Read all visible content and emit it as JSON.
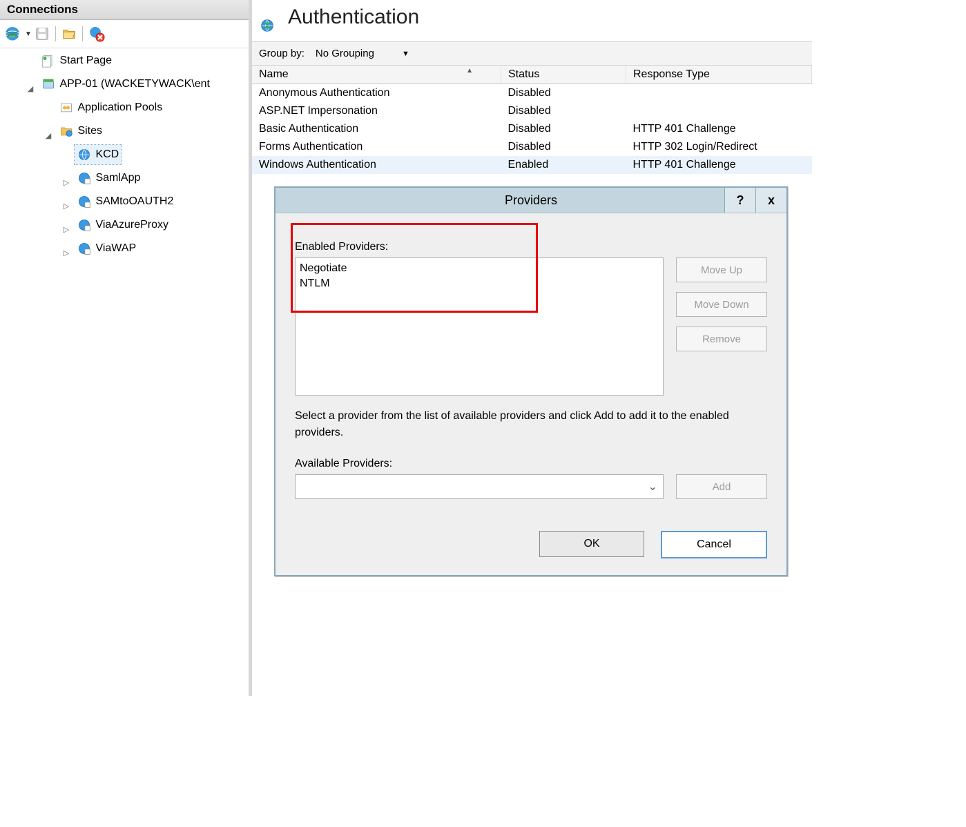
{
  "left": {
    "title": "Connections",
    "tree": {
      "start_page": "Start Page",
      "server": "APP-01 (WACKETYWACK\\ent",
      "app_pools": "Application Pools",
      "sites_label": "Sites",
      "sites": [
        "KCD",
        "SamlApp",
        "SAMtoOAUTH2",
        "ViaAzureProxy",
        "ViaWAP"
      ],
      "selected_site_index": 0
    }
  },
  "header": {
    "title": "Authentication"
  },
  "group_by": {
    "label": "Group by:",
    "value": "No Grouping"
  },
  "grid": {
    "columns": [
      "Name",
      "Status",
      "Response Type"
    ],
    "rows": [
      {
        "name": "Anonymous Authentication",
        "status": "Disabled",
        "response": ""
      },
      {
        "name": "ASP.NET Impersonation",
        "status": "Disabled",
        "response": ""
      },
      {
        "name": "Basic Authentication",
        "status": "Disabled",
        "response": "HTTP 401 Challenge"
      },
      {
        "name": "Forms Authentication",
        "status": "Disabled",
        "response": "HTTP 302 Login/Redirect"
      },
      {
        "name": "Windows Authentication",
        "status": "Enabled",
        "response": "HTTP 401 Challenge"
      }
    ],
    "selected_row_index": 4
  },
  "dialog": {
    "title": "Providers",
    "help_label": "?",
    "close_label": "x",
    "enabled_label": "Enabled Providers:",
    "enabled": [
      "Negotiate",
      "NTLM"
    ],
    "move_up": "Move Up",
    "move_down": "Move Down",
    "remove": "Remove",
    "instruction": "Select a provider from the list of available providers and click Add to add it to the enabled providers.",
    "available_label": "Available Providers:",
    "add": "Add",
    "ok": "OK",
    "cancel": "Cancel"
  }
}
